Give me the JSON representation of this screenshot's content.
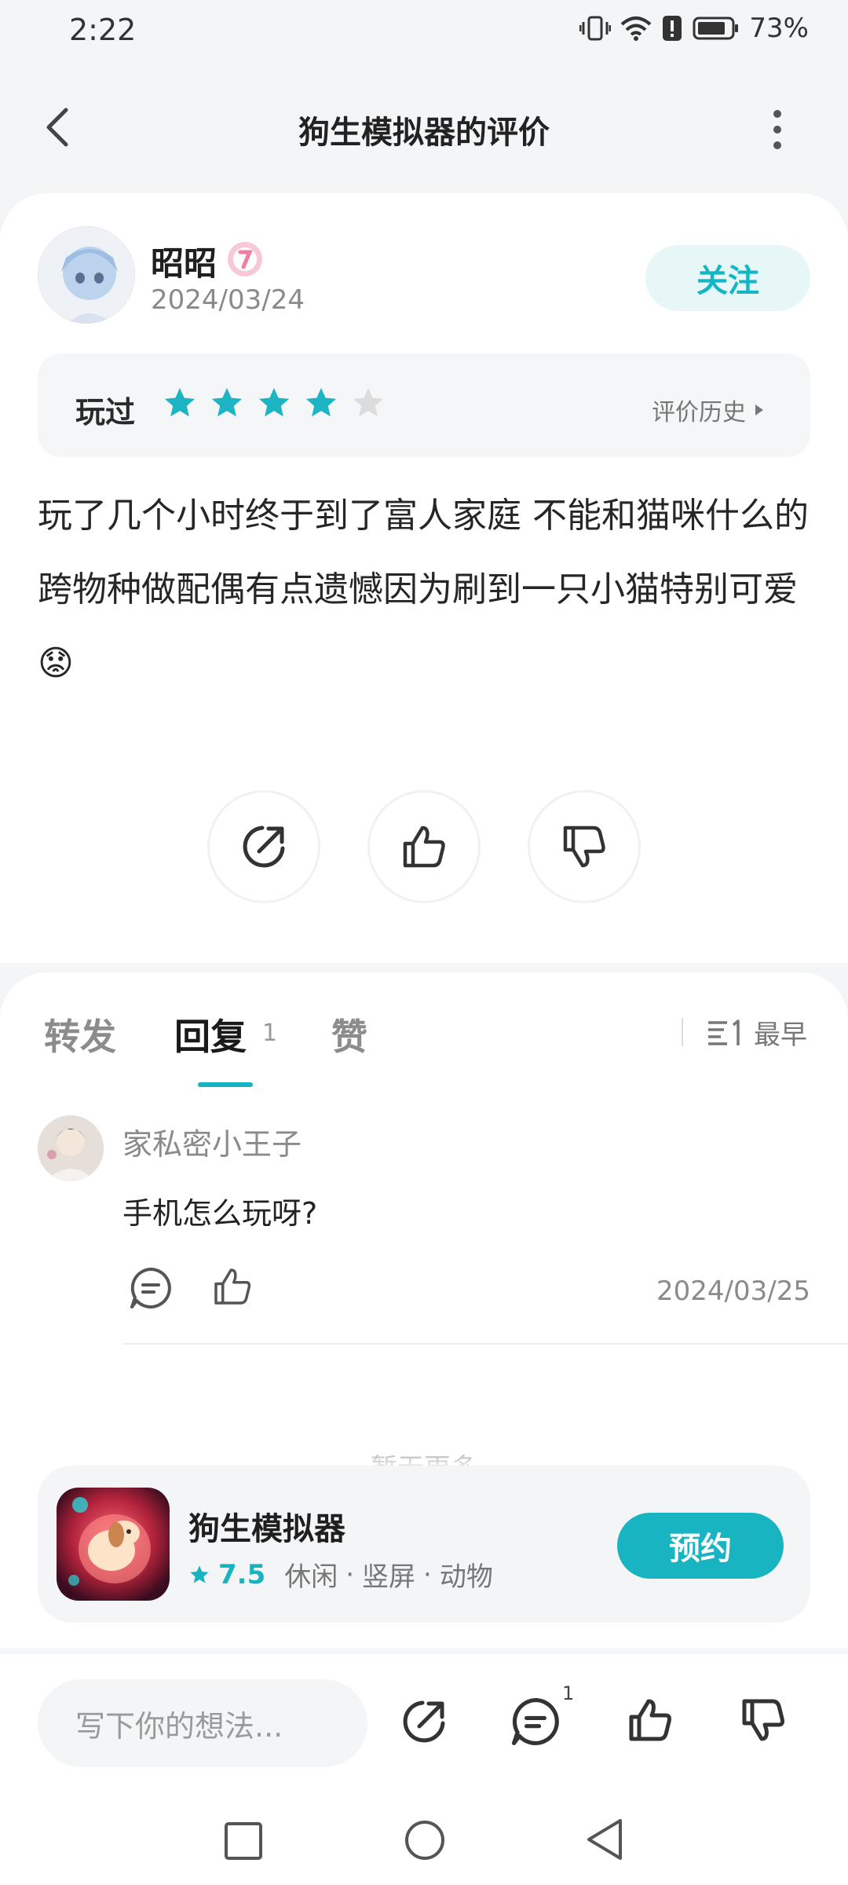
{
  "status_bar": {
    "time": "2:22",
    "battery_percent": "73%"
  },
  "header": {
    "title": "狗生模拟器的评价"
  },
  "review": {
    "username": "昭昭",
    "date": "2024/03/24",
    "follow_label": "关注",
    "played_label": "玩过",
    "rating_stars": 4,
    "rating_max": 5,
    "history_label": "评价历史",
    "text": "玩了几个小时终于到了富人家庭 不能和猫咪什么的跨物种做配偶有点遗憾因为刷到一只小猫特别可爱😟"
  },
  "tabs": {
    "repost": "转发",
    "reply": "回复",
    "reply_count": "1",
    "like": "赞",
    "sort_label": "最早"
  },
  "reply": {
    "username": "家私密小王子",
    "text": "手机怎么玩呀?",
    "date": "2024/03/25"
  },
  "no_more": "暂无更多",
  "game": {
    "name": "狗生模拟器",
    "score": "7.5",
    "tags": [
      "休闲",
      "竖屏",
      "动物"
    ],
    "reserve_label": "预约"
  },
  "bottom_bar": {
    "input_placeholder": "写下你的想法...",
    "comment_count": "1"
  },
  "colors": {
    "accent": "#19b4c2",
    "star_filled": "#1db5c4",
    "star_empty": "#dcdcdc"
  }
}
